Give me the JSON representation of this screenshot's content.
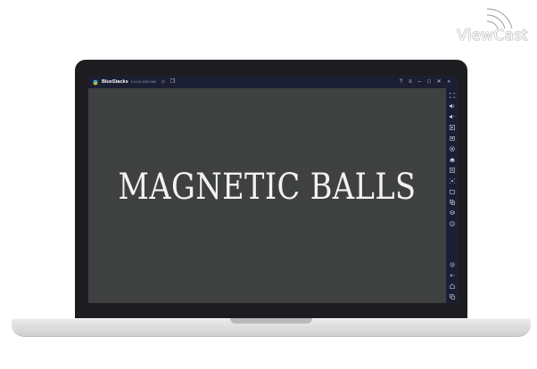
{
  "watermark": {
    "text": "ViewCast"
  },
  "window": {
    "app_name": "BlueStacks",
    "version": "5.9.110.1002 N64",
    "title_icons": [
      "home-icon",
      "multi-instance-icon"
    ],
    "controls": [
      "help-icon",
      "menu-icon",
      "minimize-icon",
      "maximize-icon",
      "close-icon",
      "collapse-sidebar-icon"
    ]
  },
  "sidebar": {
    "icons": [
      "fullscreen-icon",
      "volume-up-icon",
      "volume-down-icon",
      "play-icon",
      "screenshot-icon",
      "record-icon",
      "install-apk-icon",
      "macro-icon",
      "screen-capture-icon",
      "folder-icon",
      "copy-icon",
      "layers-icon",
      "eco-mode-icon",
      "settings-icon",
      "back-icon",
      "home-icon",
      "recent-apps-icon"
    ]
  },
  "game": {
    "title": "MAGNETIC BALLS"
  },
  "colors": {
    "screen_background": "#3f4141",
    "titlebar": "#1c1e33",
    "title_text": "#f2f2f2",
    "bezel": "#1d1d21"
  }
}
